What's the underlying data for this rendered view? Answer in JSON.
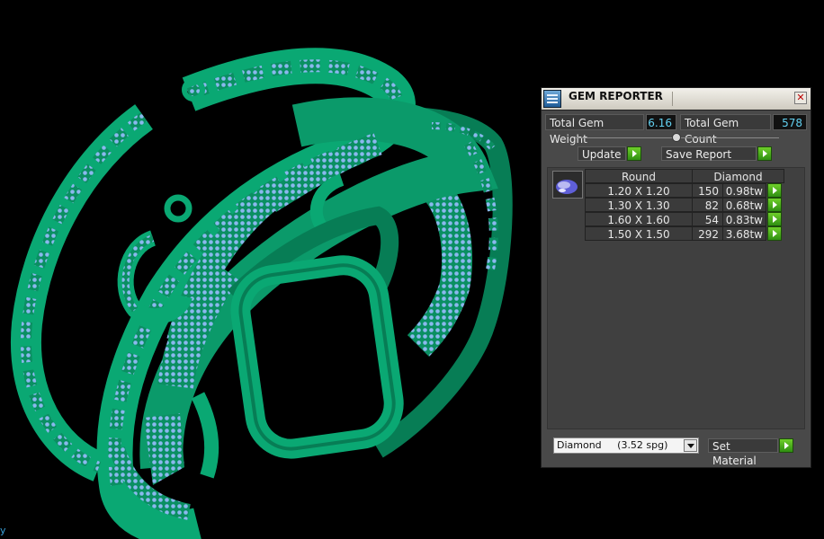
{
  "viewport": {
    "metal_color": "#0aa873",
    "gem_color": "#8ab8ee",
    "axis_indicator": "y"
  },
  "panel": {
    "title": "GEM REPORTER",
    "icon": "gem-reporter-logo-icon",
    "close_icon": "close-icon",
    "total_gem_weight_label": "Total Gem Weight",
    "total_gem_weight": "6.16",
    "total_gem_count_label": "Total Gem Count",
    "total_gem_count": "578",
    "update_label": "Update",
    "save_report_label": "Save Report",
    "table": {
      "shape_header": "Round",
      "material_header": "Diamond",
      "rows": [
        {
          "size": "1.20 X 1.20",
          "count": "150",
          "weight": "0.98tw"
        },
        {
          "size": "1.30 X 1.30",
          "count": "82",
          "weight": "0.68tw"
        },
        {
          "size": "1.60 X 1.60",
          "count": "54",
          "weight": "0.83tw"
        },
        {
          "size": "1.50 X 1.50",
          "count": "292",
          "weight": "3.68tw"
        }
      ]
    },
    "material_select_value": "Diamond     (3.52 spg)",
    "set_material_label": "Set Material",
    "accent_green": "#4caf1f",
    "value_color": "#62d0f0"
  }
}
